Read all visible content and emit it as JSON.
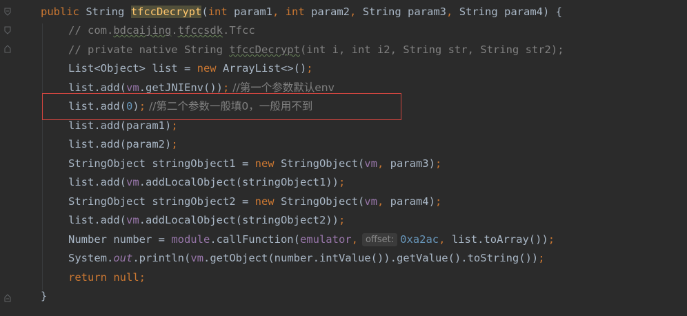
{
  "code": {
    "sig_public": "public",
    "sig_type": "String",
    "sig_name": "tfccDecrypt",
    "sig_paren_open": "(",
    "sig_int1": "int",
    "sig_param1": " param1",
    "sig_comma1": ", ",
    "sig_int2": "int",
    "sig_param2": " param2",
    "sig_comma2": ", ",
    "sig_rest": "String param3",
    "sig_comma3": ", ",
    "sig_rest2": "String param4) {",
    "c1_prefix": "// com.",
    "c1_pkg1": "bdcaijing",
    "c1_dot": ".",
    "c1_pkg2": "tfccsdk",
    "c1_suffix": ".Tfcc",
    "c2_prefix": "// private native String ",
    "c2_name": "tfccDecrypt",
    "c2_suffix": "(int i, int i2, String str, String str2);",
    "l3_a": "List<Object> list = ",
    "l3_new": "new",
    "l3_b": " ArrayList<>()",
    "l3_semi": ";",
    "l4_a": "list.add(",
    "l4_vm": "vm",
    "l4_b": ".getJNIEnv())",
    "l4_semi": ";",
    "l4_comment": " //第一个参数默认env",
    "l5_a": "list.add(",
    "l5_num": "0",
    "l5_b": ")",
    "l5_semi": ";",
    "l5_comment": " //第二个参数一般填0，一般用不到",
    "l6_a": "list.add(param1)",
    "l6_semi": ";",
    "l7_a": "list.add(param2)",
    "l7_semi": ";",
    "l8_a": "StringObject stringObject1 = ",
    "l8_new": "new",
    "l8_b": " StringObject(",
    "l8_vm": "vm",
    "l8_comma": ", ",
    "l8_c": "param3)",
    "l8_semi": ";",
    "l9_a": "list.add(",
    "l9_vm": "vm",
    "l9_b": ".addLocalObject(stringObject1))",
    "l9_semi": ";",
    "l10_a": "StringObject stringObject2 = ",
    "l10_new": "new",
    "l10_b": " StringObject(",
    "l10_vm": "vm",
    "l10_comma": ", ",
    "l10_c": "param4)",
    "l10_semi": ";",
    "l11_a": "list.add(",
    "l11_vm": "vm",
    "l11_b": ".addLocalObject(stringObject2))",
    "l11_semi": ";",
    "l12_a": "Number number = ",
    "l12_module": "module",
    "l12_b": ".callFunction(",
    "l12_emulator": "emulator",
    "l12_comma": ",",
    "l12_hint": "offset:",
    "l12_hex": "0xa2ac",
    "l12_comma2": ", ",
    "l12_c": "list.toArray())",
    "l12_semi": ";",
    "l13_a": "System.",
    "l13_out": "out",
    "l13_b": ".println(",
    "l13_vm": "vm",
    "l13_c": ".getObject(number.intValue()).getValue().toString())",
    "l13_semi": ";",
    "l14_return": "return",
    "l14_null": " null",
    "l14_semi": ";",
    "l15_brace": "}"
  },
  "colors": {
    "background": "#2b2b2b",
    "default_text": "#a9b7c6",
    "keyword": "#cc7832",
    "method_decl": "#ffc66d",
    "comment": "#808080",
    "number": "#6897bb",
    "field": "#9876aa",
    "highlight_border": "#d0453f"
  },
  "icons": {
    "fold_markers": [
      "fold-open-icon",
      "fold-close-icon",
      "fold-close-icon"
    ]
  }
}
